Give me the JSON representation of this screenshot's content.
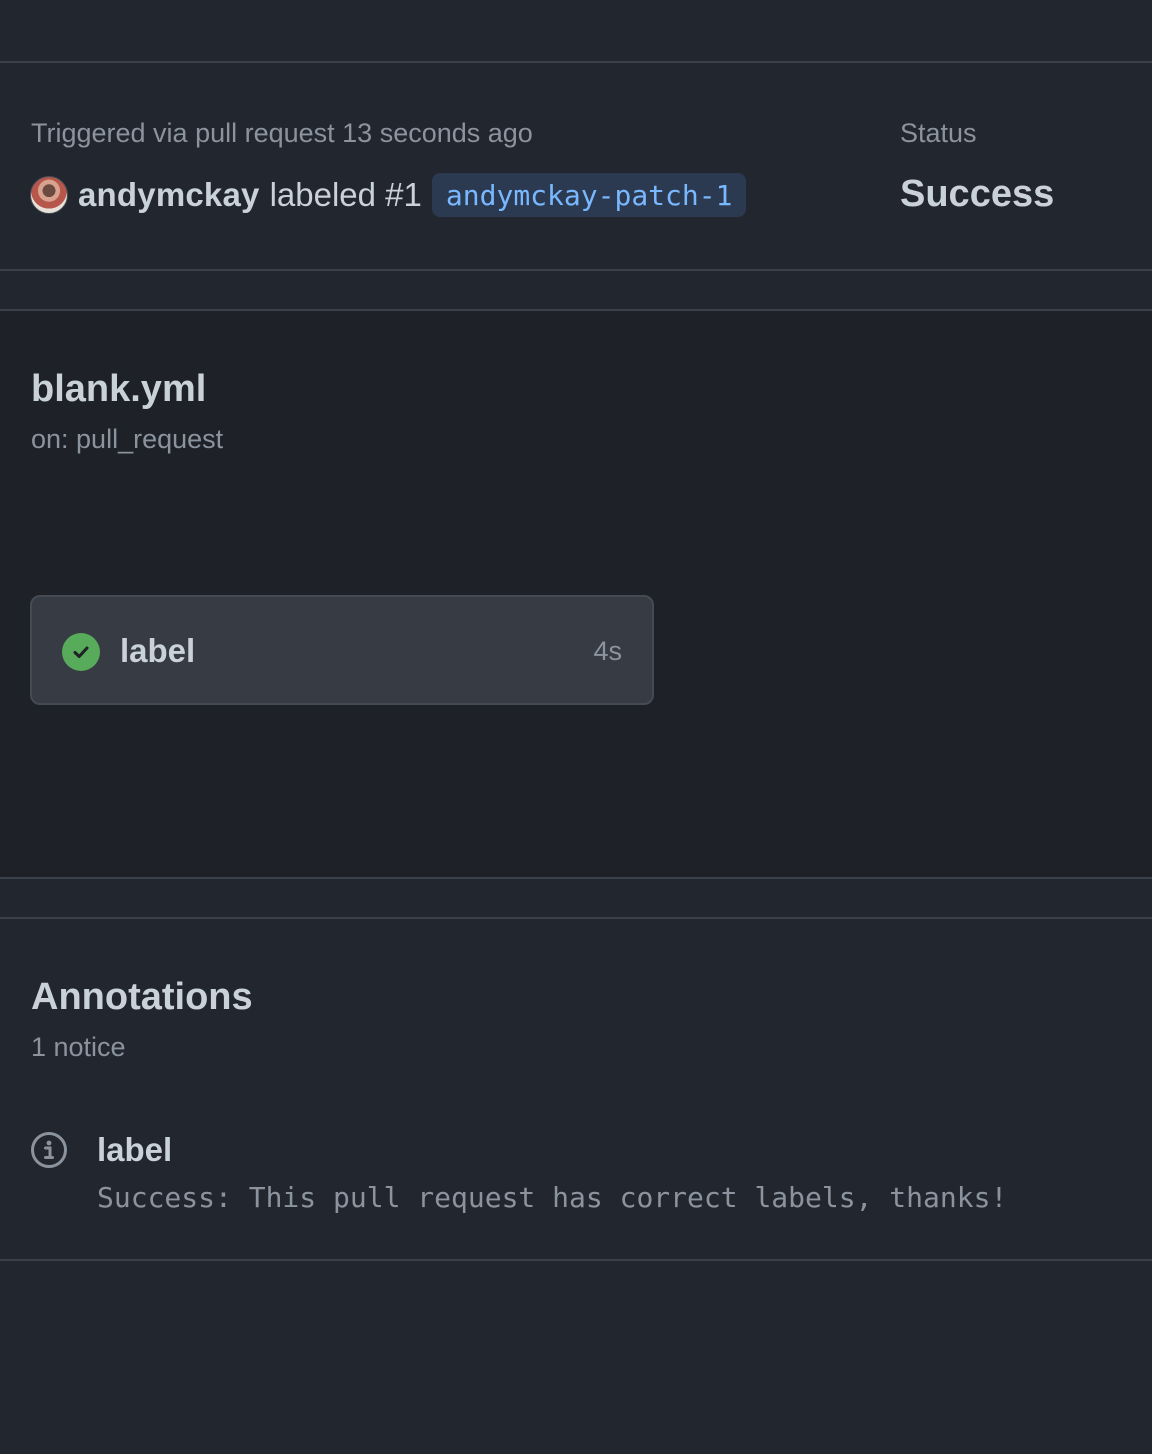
{
  "summary": {
    "trigger_text": "Triggered via pull request 13 seconds ago",
    "actor": "andymckay",
    "action": "labeled #1",
    "branch": "andymckay-patch-1",
    "status_label": "Status",
    "status_value": "Success"
  },
  "workflow": {
    "file": "blank.yml",
    "trigger": "on: pull_request",
    "jobs": [
      {
        "name": "label",
        "duration": "4s",
        "status": "success",
        "status_icon": "check-circle-icon"
      }
    ]
  },
  "annotations": {
    "title": "Annotations",
    "count_text": "1 notice",
    "items": [
      {
        "icon": "info-icon",
        "name": "label",
        "message": "Success: This pull request has correct labels, thanks!"
      }
    ]
  },
  "colors": {
    "background": "#22262e",
    "graph_background": "#1e2128",
    "success_green": "#57ab5a",
    "branch_chip_bg": "#2b3a50",
    "branch_chip_text": "#79b8ff"
  }
}
